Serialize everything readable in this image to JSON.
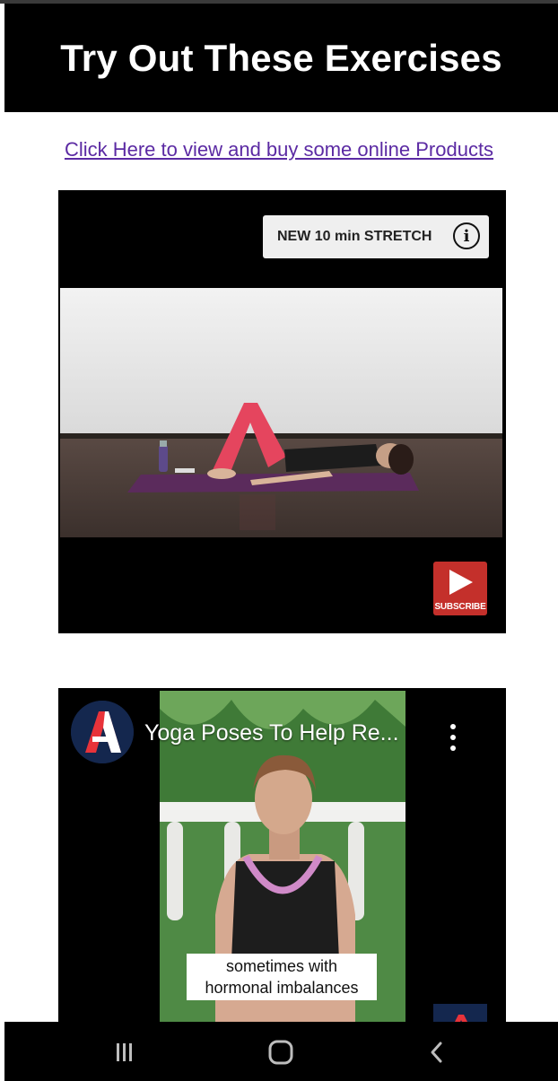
{
  "header": {
    "title": "Try Out These Exercises"
  },
  "promo_link": {
    "text": "Click Here to view and buy some online Products"
  },
  "video1": {
    "chip_label": "NEW 10 min STRETCH",
    "subscribe_label": "SUBSCRIBE"
  },
  "video2": {
    "title": "Yoga Poses To Help Re...",
    "caption_line1": "sometimes with",
    "caption_line2": "hormonal imbalances"
  },
  "colors": {
    "header_bg": "#000000",
    "link": "#5b2aa3",
    "subscribe_red": "#c4302b",
    "channel_navy": "#14274e",
    "channel_red": "#e8333a"
  },
  "icons": {
    "info": "info-icon",
    "subscribe": "play-icon",
    "more": "more-vertical-icon",
    "recents": "recents-icon",
    "home": "home-icon",
    "back": "back-icon"
  }
}
